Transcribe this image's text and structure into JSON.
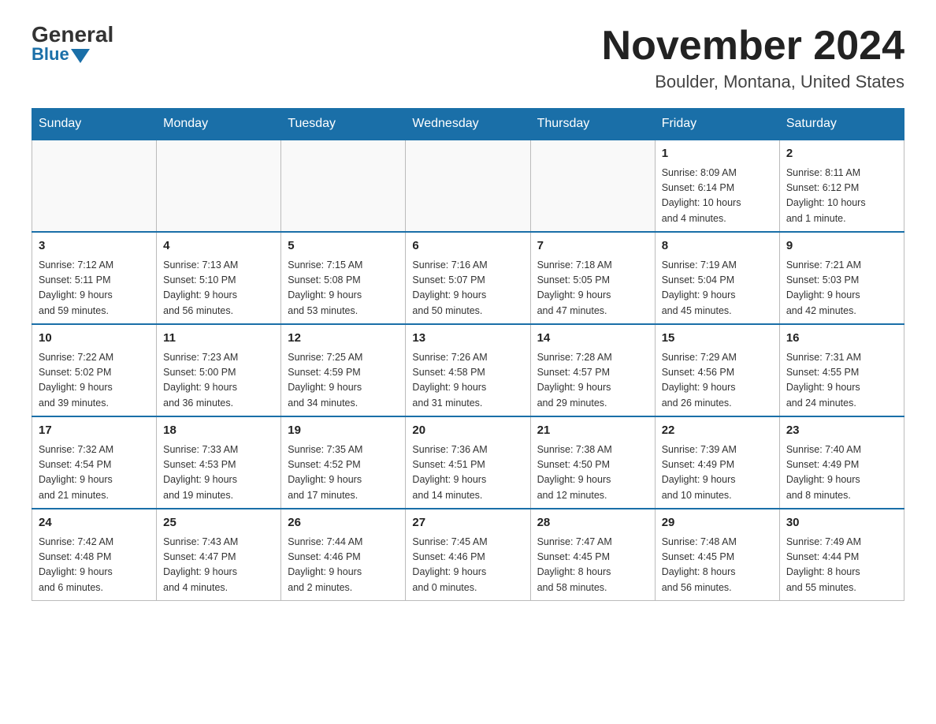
{
  "header": {
    "logo_general": "General",
    "logo_blue": "Blue",
    "month_title": "November 2024",
    "location": "Boulder, Montana, United States"
  },
  "weekdays": [
    "Sunday",
    "Monday",
    "Tuesday",
    "Wednesday",
    "Thursday",
    "Friday",
    "Saturday"
  ],
  "weeks": [
    [
      {
        "day": "",
        "info": ""
      },
      {
        "day": "",
        "info": ""
      },
      {
        "day": "",
        "info": ""
      },
      {
        "day": "",
        "info": ""
      },
      {
        "day": "",
        "info": ""
      },
      {
        "day": "1",
        "info": "Sunrise: 8:09 AM\nSunset: 6:14 PM\nDaylight: 10 hours\nand 4 minutes."
      },
      {
        "day": "2",
        "info": "Sunrise: 8:11 AM\nSunset: 6:12 PM\nDaylight: 10 hours\nand 1 minute."
      }
    ],
    [
      {
        "day": "3",
        "info": "Sunrise: 7:12 AM\nSunset: 5:11 PM\nDaylight: 9 hours\nand 59 minutes."
      },
      {
        "day": "4",
        "info": "Sunrise: 7:13 AM\nSunset: 5:10 PM\nDaylight: 9 hours\nand 56 minutes."
      },
      {
        "day": "5",
        "info": "Sunrise: 7:15 AM\nSunset: 5:08 PM\nDaylight: 9 hours\nand 53 minutes."
      },
      {
        "day": "6",
        "info": "Sunrise: 7:16 AM\nSunset: 5:07 PM\nDaylight: 9 hours\nand 50 minutes."
      },
      {
        "day": "7",
        "info": "Sunrise: 7:18 AM\nSunset: 5:05 PM\nDaylight: 9 hours\nand 47 minutes."
      },
      {
        "day": "8",
        "info": "Sunrise: 7:19 AM\nSunset: 5:04 PM\nDaylight: 9 hours\nand 45 minutes."
      },
      {
        "day": "9",
        "info": "Sunrise: 7:21 AM\nSunset: 5:03 PM\nDaylight: 9 hours\nand 42 minutes."
      }
    ],
    [
      {
        "day": "10",
        "info": "Sunrise: 7:22 AM\nSunset: 5:02 PM\nDaylight: 9 hours\nand 39 minutes."
      },
      {
        "day": "11",
        "info": "Sunrise: 7:23 AM\nSunset: 5:00 PM\nDaylight: 9 hours\nand 36 minutes."
      },
      {
        "day": "12",
        "info": "Sunrise: 7:25 AM\nSunset: 4:59 PM\nDaylight: 9 hours\nand 34 minutes."
      },
      {
        "day": "13",
        "info": "Sunrise: 7:26 AM\nSunset: 4:58 PM\nDaylight: 9 hours\nand 31 minutes."
      },
      {
        "day": "14",
        "info": "Sunrise: 7:28 AM\nSunset: 4:57 PM\nDaylight: 9 hours\nand 29 minutes."
      },
      {
        "day": "15",
        "info": "Sunrise: 7:29 AM\nSunset: 4:56 PM\nDaylight: 9 hours\nand 26 minutes."
      },
      {
        "day": "16",
        "info": "Sunrise: 7:31 AM\nSunset: 4:55 PM\nDaylight: 9 hours\nand 24 minutes."
      }
    ],
    [
      {
        "day": "17",
        "info": "Sunrise: 7:32 AM\nSunset: 4:54 PM\nDaylight: 9 hours\nand 21 minutes."
      },
      {
        "day": "18",
        "info": "Sunrise: 7:33 AM\nSunset: 4:53 PM\nDaylight: 9 hours\nand 19 minutes."
      },
      {
        "day": "19",
        "info": "Sunrise: 7:35 AM\nSunset: 4:52 PM\nDaylight: 9 hours\nand 17 minutes."
      },
      {
        "day": "20",
        "info": "Sunrise: 7:36 AM\nSunset: 4:51 PM\nDaylight: 9 hours\nand 14 minutes."
      },
      {
        "day": "21",
        "info": "Sunrise: 7:38 AM\nSunset: 4:50 PM\nDaylight: 9 hours\nand 12 minutes."
      },
      {
        "day": "22",
        "info": "Sunrise: 7:39 AM\nSunset: 4:49 PM\nDaylight: 9 hours\nand 10 minutes."
      },
      {
        "day": "23",
        "info": "Sunrise: 7:40 AM\nSunset: 4:49 PM\nDaylight: 9 hours\nand 8 minutes."
      }
    ],
    [
      {
        "day": "24",
        "info": "Sunrise: 7:42 AM\nSunset: 4:48 PM\nDaylight: 9 hours\nand 6 minutes."
      },
      {
        "day": "25",
        "info": "Sunrise: 7:43 AM\nSunset: 4:47 PM\nDaylight: 9 hours\nand 4 minutes."
      },
      {
        "day": "26",
        "info": "Sunrise: 7:44 AM\nSunset: 4:46 PM\nDaylight: 9 hours\nand 2 minutes."
      },
      {
        "day": "27",
        "info": "Sunrise: 7:45 AM\nSunset: 4:46 PM\nDaylight: 9 hours\nand 0 minutes."
      },
      {
        "day": "28",
        "info": "Sunrise: 7:47 AM\nSunset: 4:45 PM\nDaylight: 8 hours\nand 58 minutes."
      },
      {
        "day": "29",
        "info": "Sunrise: 7:48 AM\nSunset: 4:45 PM\nDaylight: 8 hours\nand 56 minutes."
      },
      {
        "day": "30",
        "info": "Sunrise: 7:49 AM\nSunset: 4:44 PM\nDaylight: 8 hours\nand 55 minutes."
      }
    ]
  ]
}
